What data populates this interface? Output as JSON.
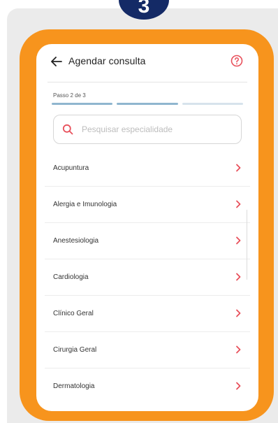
{
  "badge": {
    "number": "3"
  },
  "header": {
    "title": "Agendar consulta"
  },
  "step": {
    "text": "Passo 2 de 3",
    "current": 2,
    "total": 3
  },
  "search": {
    "placeholder": "Pesquisar especialidade",
    "value": ""
  },
  "specialties": [
    "Acupuntura",
    "Alergia e Imunologia",
    "Anestesiologia",
    "Cardiologia",
    "Clínico Geral",
    "Cirurgia Geral",
    "Dermatologia"
  ],
  "colors": {
    "frame": "#f7941d",
    "badge": "#142a66",
    "accent": "#e8505b",
    "progress_done": "#8fb6cf",
    "progress_pending": "#d7e3ec"
  },
  "icons": {
    "back": "arrow-left-icon",
    "help": "help-circle-icon",
    "search": "search-icon",
    "chevron": "chevron-right-icon"
  }
}
